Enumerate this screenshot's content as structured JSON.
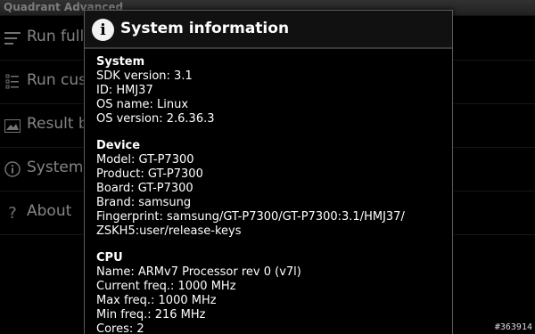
{
  "app": {
    "title": "Quadrant Advanced"
  },
  "menu": {
    "items": [
      {
        "label": "Run full benchmark",
        "icon": "list-icon"
      },
      {
        "label": "Run custom",
        "icon": "checklist-icon"
      },
      {
        "label": "Result browser",
        "icon": "image-icon"
      },
      {
        "label": "System info",
        "icon": "info-icon"
      },
      {
        "label": "About",
        "icon": "question-icon"
      }
    ]
  },
  "dialog": {
    "title": "System information",
    "icon": "info-icon",
    "sections": [
      {
        "heading": "System",
        "rows": [
          "SDK version: 3.1",
          "ID: HMJ37",
          "OS name: Linux",
          "OS version: 2.6.36.3"
        ]
      },
      {
        "heading": "Device",
        "rows": [
          "Model: GT-P7300",
          "Product: GT-P7300",
          "Board: GT-P7300",
          "Brand: samsung",
          "Fingerprint: samsung/GT-P7300/GT-P7300:3.1/HMJ37/",
          "ZSKH5:user/release-keys"
        ]
      },
      {
        "heading": "CPU",
        "rows": [
          "Name: ARMv7 Processor rev 0 (v7l)",
          "Current freq.: 1000 MHz",
          "Max freq.: 1000 MHz",
          "Min freq.: 216 MHz",
          "Cores: 2"
        ]
      }
    ]
  },
  "watermark": "#363914"
}
